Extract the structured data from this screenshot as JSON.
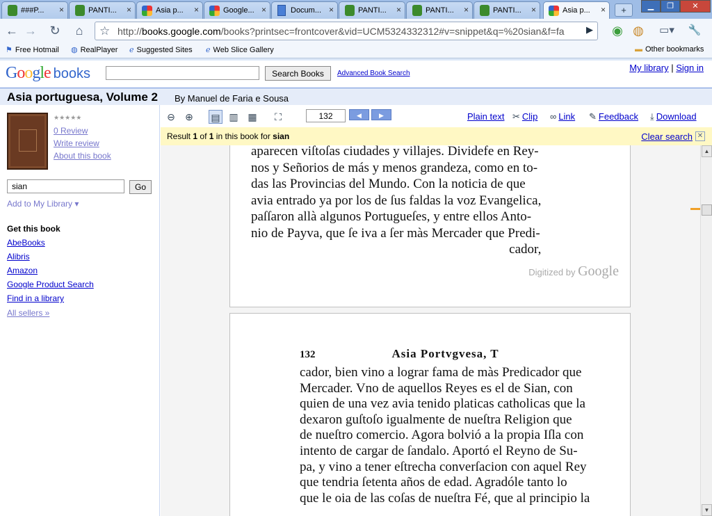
{
  "browser": {
    "tabs": [
      {
        "label": "###P...",
        "icon": "cactus-icon",
        "active": false
      },
      {
        "label": "PANTI...",
        "icon": "cactus-icon",
        "active": false
      },
      {
        "label": "Asia p...",
        "icon": "google-books-icon",
        "active": false
      },
      {
        "label": "Google...",
        "icon": "google-icon",
        "active": false
      },
      {
        "label": "Docum...",
        "icon": "google-docs-icon",
        "active": false
      },
      {
        "label": "PANTI...",
        "icon": "cactus-icon",
        "active": false
      },
      {
        "label": "PANTI...",
        "icon": "cactus-icon",
        "active": false
      },
      {
        "label": "PANTI...",
        "icon": "cactus-icon",
        "active": false
      },
      {
        "label": "Asia p...",
        "icon": "google-books-icon",
        "active": true
      }
    ],
    "new_tab": "+",
    "url_scheme": "http://",
    "url_host": "books.google.com",
    "url_rest": "/books?printsec=frontcover&vid=UCM5324332312#v=snippet&q=%20sian&f=fa",
    "bookmarks": [
      {
        "label": "Free Hotmail",
        "icon": "windows-flag-icon"
      },
      {
        "label": "RealPlayer",
        "icon": "realplayer-icon"
      },
      {
        "label": "Suggested Sites",
        "icon": "ie-icon"
      },
      {
        "label": "Web Slice Gallery",
        "icon": "ie-icon"
      }
    ],
    "other_bookmarks": "Other bookmarks"
  },
  "header": {
    "logo_google": "Google",
    "logo_books": "books",
    "search_value": "",
    "search_button": "Search Books",
    "advanced": "Advanced Book Search",
    "my_library": "My library",
    "separator": "|",
    "sign_in": "Sign in"
  },
  "book": {
    "title": "Asia portuguesa, Volume 2",
    "byline": "By Manuel de Faria e Sousa",
    "stars": "★★★★★",
    "review_count": "0 Review",
    "write_review": "Write review",
    "about": "About this book",
    "search_value": "sian",
    "go": "Go",
    "add_library": "Add to My Library ▾",
    "get_title": "Get this book",
    "sellers": [
      "AbeBooks",
      "Alibris",
      "Amazon",
      "Google Product Search",
      "Find in a library"
    ],
    "all_sellers": "All sellers »"
  },
  "viewer": {
    "page_number": "132",
    "plain_text": "Plain text",
    "clip": "Clip",
    "link": "Link",
    "feedback": "Feedback",
    "download": "Download",
    "result_prefix": "Result",
    "result_num": "1",
    "result_of": "of",
    "result_total": "1",
    "result_suffix": "in this book for",
    "result_query": "sian",
    "clear_search": "Clear search",
    "digitized_by": "Digitized by",
    "digitized_google": "Google",
    "page1_lines": [
      "aparecen viſtoſas ciudades y villajes. Dividefe en Rey-",
      "nos y Señorios de más y menos grandeza, como en to-",
      "das las Provincias del Mundo. Con la noticia de que",
      "avia entrado ya por los de ſus faldas la voz Evangelica,",
      "paſſaron allà algunos Portugueſes, y entre ellos Anto-",
      "nio de Payva, que ſe iva a ſer màs Mercader que Predi-"
    ],
    "page1_last": "cador,",
    "page2_number": "132",
    "page2_running_head": "Asia Portvgvesa, T",
    "page2_lines": [
      "cador, bien vino a lograr fama de màs Predicador que",
      "Mercader. Vno de aquellos Reyes es el de Sian, con",
      "quien de una vez avia tenido platicas catholicas que la",
      "dexaron guſtoſo igualmente de nueſtra Religion que",
      "de nueſtro comercio. Agora bolvió a la propia Iſla con",
      "intento de cargar de ſandalo. Aportó el Reyno de Su-",
      "pa, y vino a tener eſtrecha converſacion con aquel Rey",
      "que tendria ſetenta años de edad. Agradóle tanto lo",
      "que le oia de las coſas de nueſtra Fé, que al principio la"
    ]
  }
}
